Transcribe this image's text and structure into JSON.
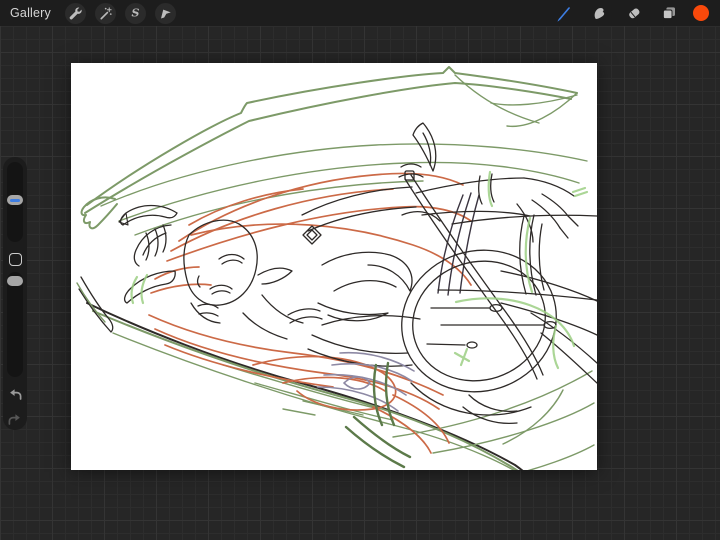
{
  "topbar": {
    "gallery_label": "Gallery",
    "left_tools": [
      {
        "id": "actions",
        "icon": "wrench-icon"
      },
      {
        "id": "adjustments",
        "icon": "magic-wand-icon"
      },
      {
        "id": "selection",
        "icon": "selection-s-icon",
        "glyph": "S"
      },
      {
        "id": "transform",
        "icon": "transform-arrow-icon"
      }
    ],
    "right_tools": [
      {
        "id": "paint",
        "icon": "paintbrush-icon",
        "active": true
      },
      {
        "id": "smudge",
        "icon": "smudge-finger-icon",
        "active": false
      },
      {
        "id": "erase",
        "icon": "eraser-icon",
        "active": false
      },
      {
        "id": "layers",
        "icon": "layers-icon",
        "active": false
      },
      {
        "id": "color",
        "icon": "color-swatch",
        "color": "#f8490b"
      }
    ],
    "active_tool_color": "#3d7de2"
  },
  "sidebar": {
    "brush_size_slider": {
      "handle_accent": "#3d7de2",
      "handle_position_from_top": "47%"
    },
    "opacity_slider": {
      "handle_position_from_top": "5%"
    },
    "modify_button": {
      "shape": "rounded-square"
    },
    "undo_enabled": true,
    "redo_enabled": false
  },
  "canvas": {
    "background": "#ffffff",
    "artwork": {
      "description": "line-art sketch of a horned, winged female character lying horizontally with flowing hair, holding a spear; green wing outlines above and below the figure",
      "palette": {
        "wing_green": "#7d9a68",
        "dark_green": "#5c7a4a",
        "light_green": "#9ccf84",
        "hair_orange": "#cc6a47",
        "ink": "#2e2a28",
        "slate": "#8d89a4"
      }
    }
  },
  "workspace": {
    "background": "#262626",
    "grid_line": "#2d2d2d",
    "grid_major": "#343434",
    "topbar_background": "#1d1d1d",
    "sidebar_background": "#1c1c1c"
  }
}
